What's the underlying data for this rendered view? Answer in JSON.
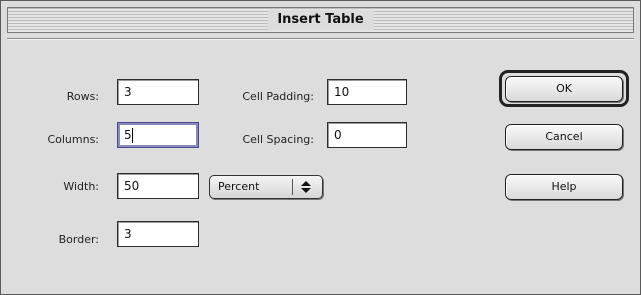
{
  "dialog": {
    "title": "Insert Table"
  },
  "fields": {
    "rows": {
      "label": "Rows:",
      "value": "3"
    },
    "columns": {
      "label": "Columns:",
      "value": "5"
    },
    "width": {
      "label": "Width:",
      "value": "50"
    },
    "border": {
      "label": "Border:",
      "value": "3"
    },
    "cell_padding": {
      "label": "Cell Padding:",
      "value": "10"
    },
    "cell_spacing": {
      "label": "Cell Spacing:",
      "value": "0"
    }
  },
  "width_units": {
    "selected": "Percent",
    "icon": "up-down-arrows-icon"
  },
  "buttons": {
    "ok": "OK",
    "cancel": "Cancel",
    "help": "Help"
  },
  "colors": {
    "dialog_background": "#dddddd",
    "field_background": "#ffffff",
    "focus_ring": "#8a8abf"
  }
}
